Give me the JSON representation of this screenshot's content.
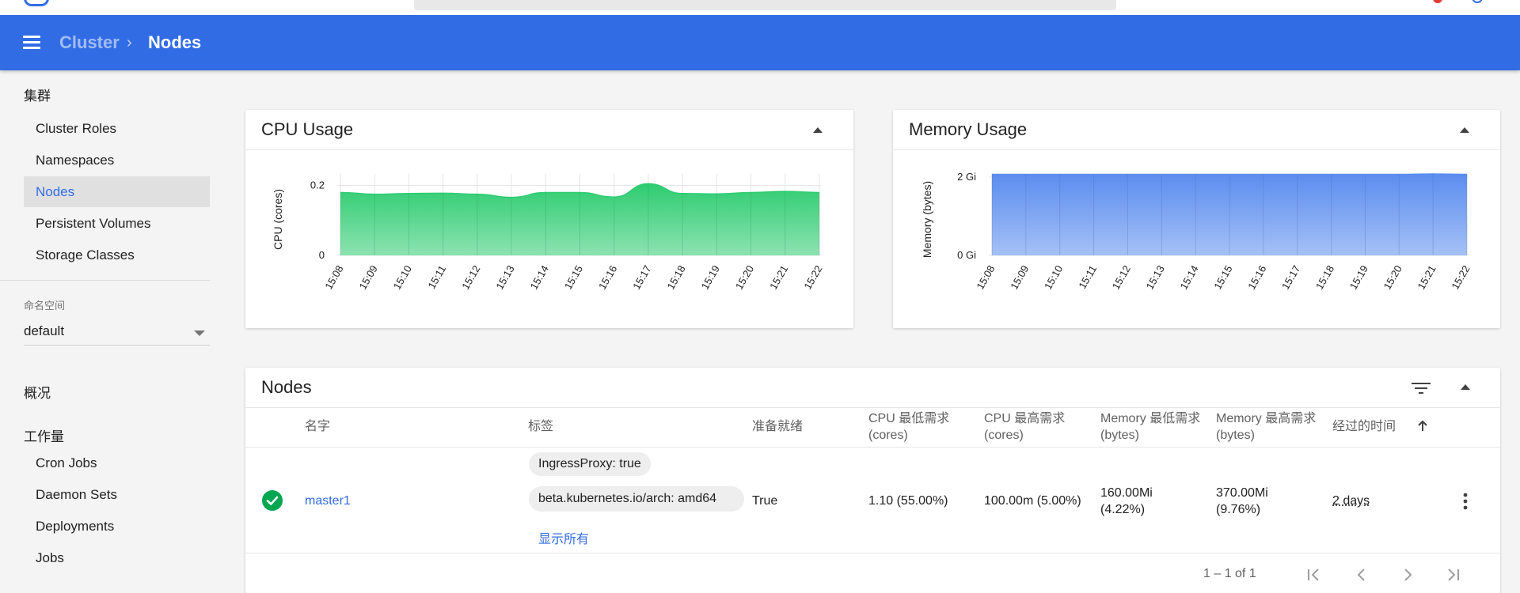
{
  "header": {
    "menu_icon": "menu-icon",
    "breadcrumb": {
      "parent": "Cluster",
      "separator": "›",
      "current": "Nodes"
    }
  },
  "sidebar": {
    "cluster_section": "集群",
    "cluster_items": [
      "Cluster Roles",
      "Namespaces",
      "Nodes",
      "Persistent Volumes",
      "Storage Classes"
    ],
    "active_item": "Nodes",
    "namespace_label": "命名空间",
    "namespace_value": "default",
    "overview_section": "概况",
    "workloads_section": "工作量",
    "workload_items": [
      "Cron Jobs",
      "Daemon Sets",
      "Deployments",
      "Jobs"
    ]
  },
  "cpu_card": {
    "title": "CPU Usage",
    "color": "#2ecc71"
  },
  "memory_card": {
    "title": "Memory Usage",
    "color": "#5b8def"
  },
  "chart_data": [
    {
      "type": "area",
      "ylabel": "CPU (cores)",
      "yticks": [
        "0",
        "0.2"
      ],
      "ylim": [
        0,
        0.2
      ],
      "x": [
        "15:08",
        "15:09",
        "15:10",
        "15:11",
        "15:12",
        "15:13",
        "15:14",
        "15:15",
        "15:16",
        "15:17",
        "15:18",
        "15:19",
        "15:20",
        "15:21",
        "15:22"
      ],
      "series": [
        {
          "values": [
            0.18,
            0.175,
            0.177,
            0.178,
            0.175,
            0.166,
            0.18,
            0.18,
            0.167,
            0.205,
            0.177,
            0.176,
            0.18,
            0.183,
            0.18
          ]
        }
      ],
      "grid": true
    },
    {
      "type": "area",
      "ylabel": "Memory (bytes)",
      "yticks": [
        "0 Gi",
        "2 Gi"
      ],
      "ylim": [
        0,
        2
      ],
      "x": [
        "15:08",
        "15:09",
        "15:10",
        "15:11",
        "15:12",
        "15:13",
        "15:14",
        "15:15",
        "15:16",
        "15:17",
        "15:18",
        "15:19",
        "15:20",
        "15:21",
        "15:22"
      ],
      "series": [
        {
          "values": [
            2.07,
            2.07,
            2.07,
            2.07,
            2.07,
            2.07,
            2.07,
            2.07,
            2.07,
            2.07,
            2.07,
            2.07,
            2.07,
            2.08,
            2.07
          ]
        }
      ],
      "grid": true
    }
  ],
  "nodes_card": {
    "title": "Nodes",
    "filter_icon": "filter-icon",
    "columns": [
      "名字",
      "标签",
      "准备就绪",
      "CPU 最低需求 (cores)",
      "CPU 最高需求 (cores)",
      "Memory 最低需求 (bytes)",
      "Memory 最高需求 (bytes)",
      "经过的时间"
    ],
    "sort_icon": "arrow-up-icon",
    "rows": [
      {
        "status_icon": "check-circle-icon",
        "name": "master1",
        "labels": [
          "IngressProxy: true",
          "beta.kubernetes.io/arch: amd64"
        ],
        "show_all": "显示所有",
        "ready": "True",
        "cpu_requests": "1.10 (55.00%)",
        "cpu_limits": "100.00m (5.00%)",
        "mem_requests": "160.00Mi (4.22%)",
        "mem_limits": "370.00Mi (9.76%)",
        "age": "2 days"
      }
    ],
    "pagination": "1 – 1 of 1"
  }
}
